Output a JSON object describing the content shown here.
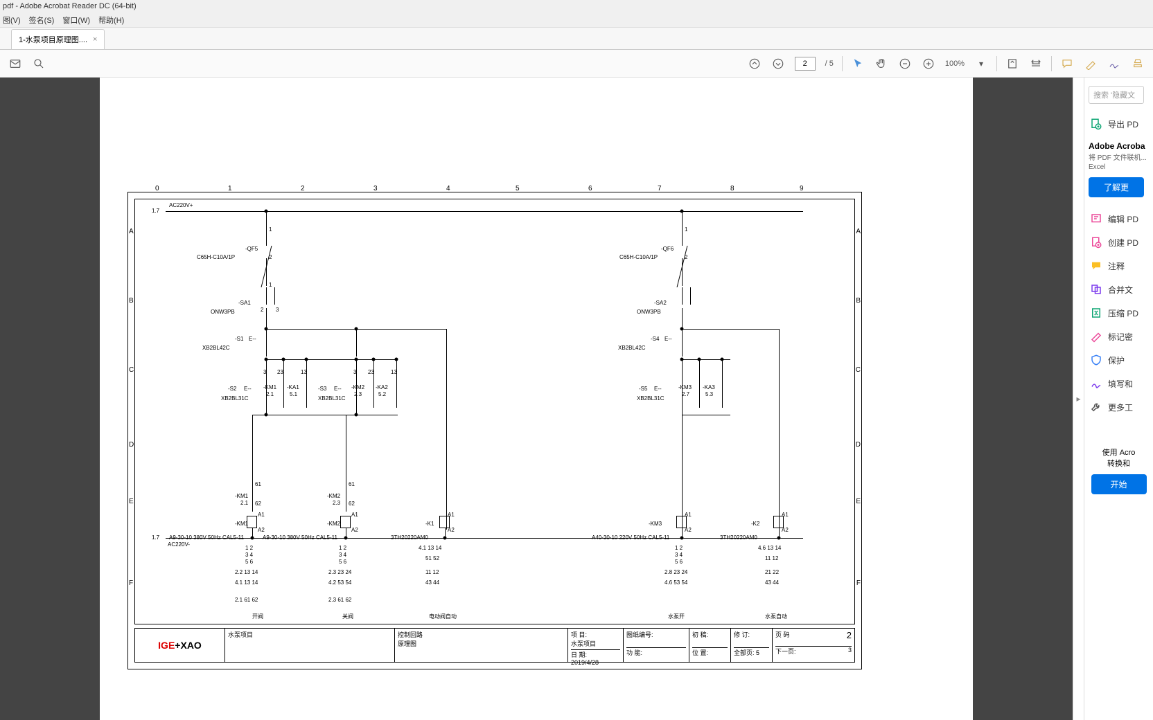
{
  "window": {
    "title": "pdf - Adobe Acrobat Reader DC (64-bit)"
  },
  "menu": {
    "view": "图(V)",
    "sign": "签名(S)",
    "window": "窗口(W)",
    "help": "帮助(H)"
  },
  "tab": {
    "label": "1-水泵项目原理图....",
    "close": "×"
  },
  "toolbar": {
    "page_current": "2",
    "page_total": "/ 5",
    "zoom": "100%"
  },
  "rightpane": {
    "search_placeholder": "搜索 '隐藏文",
    "export_pdf": "导出 PD",
    "heading": "Adobe Acroba",
    "desc": "将 PDF 文件联机... Excel",
    "learn_more": "了解更",
    "edit": "编辑 PD",
    "create": "创建 PD",
    "comment": "注释",
    "merge": "合并文",
    "compress": "压缩 PD",
    "redact": "标记密",
    "protect": "保护",
    "fill": "填写和",
    "more": "更多工",
    "footer_line1": "使用 Acro",
    "footer_line2": "转换和",
    "start": "开始"
  },
  "schematic": {
    "cols": [
      "0",
      "1",
      "2",
      "3",
      "4",
      "5",
      "6",
      "7",
      "8",
      "9"
    ],
    "rows": [
      "A",
      "B",
      "C",
      "D",
      "E",
      "F"
    ],
    "ref_in": "1.7",
    "ac_plus": "AC220V+",
    "ac_minus": "AC220V-",
    "left": {
      "qf": "-QF5",
      "qf_type": "C65H-C10A/1P",
      "sa": "-SA1",
      "sa_type": "ONW3PB",
      "s1": "-S1",
      "s1_e": "E--",
      "s1_type": "XB2BL42C",
      "s2": "-S2",
      "s3": "-S3",
      "s_e": "E--",
      "s_type": "XB2BL31C",
      "km1": "-KM1",
      "km1_ref": "2.1",
      "ka1": "-KA1",
      "ka1_ref": "5.1",
      "km2": "-KM2",
      "km2_ref_a": "2.3",
      "ka2": "-KA2",
      "ka2_ref": "5.2",
      "coil1": "-KM1",
      "coil1_spec": "A9-30-10 380V 50Hz CAL5-11",
      "coil2": "-KM2",
      "coil2_spec": "A9-30-10 380V 50Hz CAL5-11",
      "k1": "-K1",
      "k1_spec": "3TH20220AM0",
      "lbl_open": "开阀",
      "lbl_close": "关阀",
      "lbl_auto": "电动阀自动"
    },
    "right": {
      "qf": "-QF6",
      "qf_type": "C65H-C10A/1P",
      "sa": "-SA2",
      "sa_type": "ONW3PB",
      "s4": "-S4",
      "s4_type": "XB2BL42C",
      "s5": "-S5",
      "s5_type": "XB2BL31C",
      "km3": "-KM3",
      "km3_ref": "2.7",
      "ka3": "-KA3",
      "ka3_ref": "5.3",
      "coil3": "-KM3",
      "coil3_spec": "A40-30-10 220V 50Hz CAL5-11",
      "k2": "-K2",
      "k2_spec": "3TH20220AM0",
      "lbl_run": "水泵开",
      "lbl_auto": "水泵自动"
    },
    "terminals": {
      "t1": "1",
      "t2": "2",
      "t3": "3",
      "t23": "23",
      "t24": "24",
      "t13": "13",
      "t14": "14",
      "t61": "61",
      "t62": "62",
      "tA1": "A1",
      "tA2": "A2"
    },
    "contact_table_l1": [
      "1",
      "2",
      "2.2",
      "4.1",
      "2.1"
    ],
    "contact_table_l2": [
      "1",
      "2",
      "2.3",
      "4.2",
      "2.3"
    ],
    "contact_table_c1": [
      "4.1",
      "51",
      "52",
      "11"
    ],
    "contact_table_r1": [
      "1",
      "2",
      "2.8",
      "4.6"
    ],
    "contact_table_r2": [
      "4.6",
      "11",
      "12",
      "21",
      "22"
    ]
  },
  "titleblock": {
    "proj_lbl": "水泵项目",
    "sub_lbl1": "控制回路",
    "sub_lbl2": "原理图",
    "proj_k": "项 目:",
    "proj_v": "水泵项目",
    "date_k": "日 期:",
    "date_v": "2019/4/28",
    "draw_k": "图纸编号:",
    "func_k": "功 能:",
    "chk_k": "初 稿:",
    "loc_k": "位 置:",
    "rev_k": "修 订:",
    "total_k": "全部页:",
    "total_v": "5",
    "page_k": "页 码",
    "page_v": "2",
    "next_k": "下一页:",
    "next_v": "3",
    "logo1": "IGE",
    "logo2": "XAO"
  }
}
